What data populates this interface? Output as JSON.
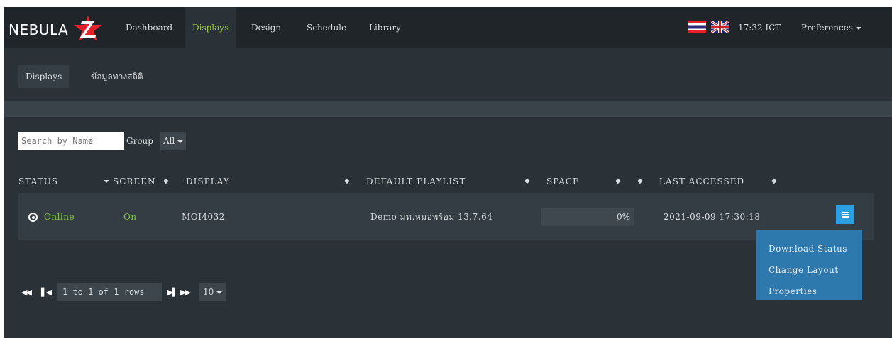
{
  "brand": {
    "name": "NEBULA"
  },
  "nav": {
    "items": [
      {
        "label": "Dashboard",
        "active": false
      },
      {
        "label": "Displays",
        "active": true
      },
      {
        "label": "Design",
        "active": false
      },
      {
        "label": "Schedule",
        "active": false
      },
      {
        "label": "Library",
        "active": false
      }
    ],
    "languages": [
      "thai-flag-icon",
      "uk-flag-icon"
    ],
    "time": "17:32 ICT",
    "preferences": "Preferences"
  },
  "subnav": {
    "tabs": [
      {
        "label": "Displays",
        "active": true
      },
      {
        "label": "ข้อมูลทางสถิติ",
        "active": false
      }
    ]
  },
  "filters": {
    "search_placeholder": "Search by Name",
    "group_label": "Group",
    "group_value": "All"
  },
  "table": {
    "headers": {
      "status": "STATUS",
      "screen": "SCREEN",
      "display": "DISPLAY",
      "default_playlist": "DEFAULT PLAYLIST",
      "space": "SPACE",
      "last_accessed": "LAST ACCESSED"
    },
    "rows": [
      {
        "status": "Online",
        "screen": "On",
        "display": "MOI4032",
        "default_playlist": "Demo มท.หมอพร้อม 13.7.64",
        "space": "0%",
        "last_accessed": "2021-09-09 17:30:18"
      }
    ]
  },
  "row_menu": {
    "items": [
      "Download Status",
      "Change Layout",
      "Properties"
    ]
  },
  "pagination": {
    "info": "1 to 1 of 1 rows",
    "page_size": "10"
  },
  "colors": {
    "accent_green": "#7fc43d",
    "nav_active": "#9acd32",
    "menu_blue": "#2d9ee0",
    "dropdown_blue": "#2d78ad"
  }
}
